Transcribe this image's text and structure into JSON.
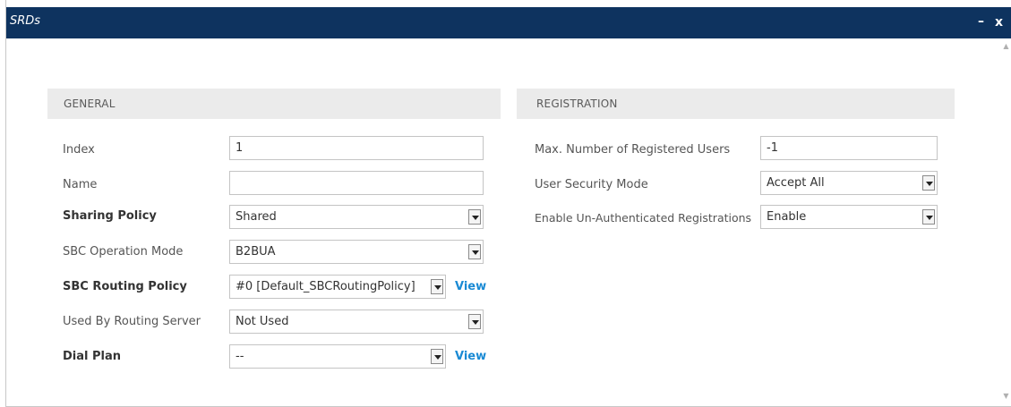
{
  "window": {
    "title": "SRDs",
    "minimize_label": "–",
    "close_label": "x"
  },
  "general": {
    "header": "GENERAL",
    "fields": [
      {
        "label": "Index",
        "value": "1",
        "kind": "text"
      },
      {
        "label": "Name",
        "value": "",
        "kind": "text"
      },
      {
        "label": "Sharing Policy",
        "value": "Shared",
        "kind": "select",
        "bold": true
      },
      {
        "label": "SBC Operation Mode",
        "value": "B2BUA",
        "kind": "select"
      },
      {
        "label": "SBC Routing Policy",
        "value": "#0 [Default_SBCRoutingPolicy]",
        "kind": "select",
        "bold": true,
        "link": "View"
      },
      {
        "label": "Used By Routing Server",
        "value": "Not Used",
        "kind": "select"
      },
      {
        "label": "Dial Plan",
        "value": "--",
        "kind": "select",
        "bold": true,
        "link": "View"
      }
    ]
  },
  "registration": {
    "header": "REGISTRATION",
    "fields": [
      {
        "label": "Max. Number of Registered Users",
        "value": "-1",
        "kind": "text"
      },
      {
        "label": "User Security Mode",
        "value": "Accept All",
        "kind": "select"
      },
      {
        "label": "Enable Un-Authenticated Registrations",
        "value": "Enable",
        "kind": "select"
      }
    ]
  }
}
